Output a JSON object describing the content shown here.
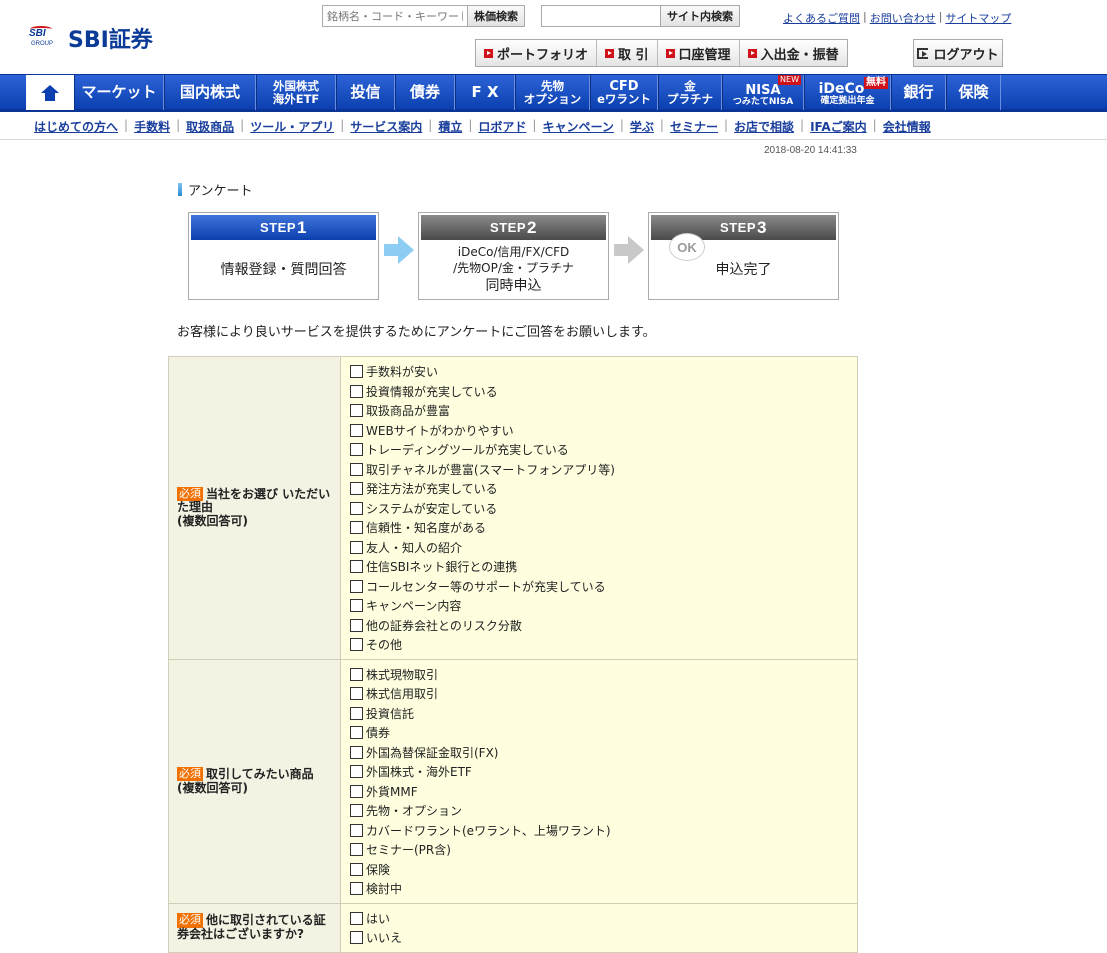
{
  "header": {
    "logo_text": "SBI証券",
    "logo_mark_text": "SBI",
    "logo_group_text": "GROUP",
    "stock_search": {
      "placeholder": "銘柄名・コード・キーワード",
      "button": "株価検索"
    },
    "site_search": {
      "placeholder": "",
      "button": "サイト内検索"
    },
    "top_links": [
      "よくあるご質問",
      "お問い合わせ",
      "サイトマップ"
    ],
    "utility_buttons": [
      "ポートフォリオ",
      "取 引",
      "口座管理",
      "入出金・振替"
    ],
    "logout": "ログアウト"
  },
  "main_nav": [
    {
      "label": "マーケット"
    },
    {
      "label": "国内株式"
    },
    {
      "label": "外国株式",
      "sub": "海外ETF"
    },
    {
      "label": "投信"
    },
    {
      "label": "債券"
    },
    {
      "label": "F X"
    },
    {
      "label": "先物",
      "sub": "オプション"
    },
    {
      "label": "CFD",
      "sub": "eワラント"
    },
    {
      "label": "金",
      "sub": "プラチナ"
    },
    {
      "label": "NISA",
      "sub": "つみたてNISA",
      "badge": "NEW"
    },
    {
      "label": "iDeCo",
      "sub": "確定拠出年金",
      "badge": "無料"
    },
    {
      "label": "銀行"
    },
    {
      "label": "保険"
    }
  ],
  "sub_nav": [
    "はじめての方へ",
    "手数料",
    "取扱商品",
    "ツール・アプリ",
    "サービス案内",
    "積立",
    "ロボアド",
    "キャンペーン",
    "学ぶ",
    "セミナー",
    "お店で相談",
    "IFAご案内",
    "会社情報"
  ],
  "timestamp": "2018-08-20 14:41:33",
  "page_title": "アンケート",
  "steps": [
    {
      "label": "STEP",
      "num": "1",
      "line1": "情報登録・質問回答"
    },
    {
      "label": "STEP",
      "num": "2",
      "line1": "iDeCo/信用/FX/CFD",
      "line2": "/先物OP/金・プラチナ",
      "line3": "同時申込"
    },
    {
      "label": "STEP",
      "num": "3",
      "line1": "申込完了",
      "ok": "OK"
    }
  ],
  "intro": "お客様により良いサービスを提供するためにアンケートにご回答をお願いします。",
  "required_label": "必須",
  "questions": [
    {
      "title": "当社をお選び いただいた理由",
      "note": "(複数回答可)",
      "options": [
        "手数料が安い",
        "投資情報が充実している",
        "取扱商品が豊富",
        "WEBサイトがわかりやすい",
        "トレーディングツールが充実している",
        "取引チャネルが豊富(スマートフォンアプリ等)",
        "発注方法が充実している",
        "システムが安定している",
        "信頼性・知名度がある",
        "友人・知人の紹介",
        "住信SBIネット銀行との連携",
        "コールセンター等のサポートが充実している",
        "キャンペーン内容",
        "他の証券会社とのリスク分散",
        "その他"
      ]
    },
    {
      "title": "取引してみたい商品",
      "note": "(複数回答可)",
      "options": [
        "株式現物取引",
        "株式信用取引",
        "投資信託",
        "債券",
        "外国為替保証金取引(FX)",
        "外国株式・海外ETF",
        "外貨MMF",
        "先物・オプション",
        "カバードワラント(eワラント、上場ワラント)",
        "セミナー(PR含)",
        "保険",
        "検討中"
      ]
    },
    {
      "title": "他に取引されている証券会社はございますか?",
      "note": "",
      "options": [
        "はい",
        "いいえ"
      ]
    }
  ]
}
